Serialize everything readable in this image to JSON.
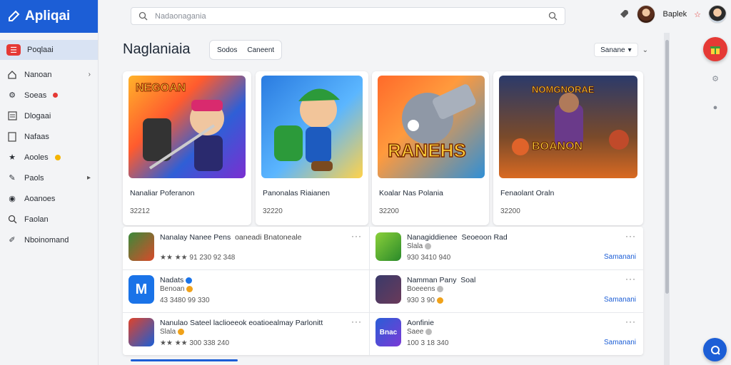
{
  "app": {
    "name": "Apliqai"
  },
  "search": {
    "placeholder": "Nadaonagania"
  },
  "user": {
    "name": "Baplek"
  },
  "sidebar": {
    "items": [
      {
        "label": "Poqlaai",
        "icon": "menu-icon",
        "active": true
      },
      {
        "label": "Nanoan",
        "icon": "home-icon",
        "chevron": true
      },
      {
        "label": "Soeas",
        "icon": "gear-icon",
        "badge": "red"
      },
      {
        "label": "Dlogaai",
        "icon": "list-icon"
      },
      {
        "label": "Nafaas",
        "icon": "document-icon"
      },
      {
        "label": "Aooles",
        "icon": "star-icon",
        "badge": "yellow"
      },
      {
        "label": "Paols",
        "icon": "pencil-icon",
        "chevron": true
      },
      {
        "label": "Aoanoes",
        "icon": "globe-icon"
      },
      {
        "label": "Faolan",
        "icon": "search-icon"
      },
      {
        "label": "Nboinomand",
        "icon": "pen-icon"
      }
    ]
  },
  "main": {
    "title": "Naglaniaia",
    "segments": [
      "Sodos",
      "Caneent"
    ],
    "sort": {
      "label": "Sanane"
    }
  },
  "cards": [
    {
      "title": "Nanaliar Poferanon",
      "meta": "32212",
      "art": "ninja"
    },
    {
      "title": "Panonalas Riaianen",
      "meta": "32220",
      "art": "runner"
    },
    {
      "title": "Koalar Nas Polania",
      "meta": "32200",
      "art": "cannon"
    },
    {
      "title": "Fenaolant Oraln",
      "meta": "32200",
      "art": "battle"
    }
  ],
  "list": [
    {
      "title": "Nanalay Nanee Pens",
      "extra": "oaneadi Bnatoneale",
      "sub": "",
      "rating": "★★ ★★ 91 230 92 348",
      "action": "",
      "thumb": "warrior"
    },
    {
      "title": "Nanagiddienee",
      "extra": "Seoeoon Rad",
      "sub": "Slala",
      "rating": "930 3410 940",
      "action": "Samanani",
      "thumb": "green"
    },
    {
      "title": "Nadats",
      "extra": "",
      "sub": "Benoan",
      "rating": "43 3480 99 330",
      "action": "",
      "thumb": "blue-m"
    },
    {
      "title": "Namman Pany",
      "extra": "Soal",
      "sub": "Boeeens",
      "rating": "930 3 90",
      "action": "Samanani",
      "thumb": "ninja"
    },
    {
      "title": "Nanulao Sateel laclioeeok",
      "extra": "eoatioealmay Parlonitt",
      "sub": "Slala",
      "rating": "★★ ★★ 300 338 240",
      "action": "",
      "thumb": "mario"
    },
    {
      "title": "Aonfinie",
      "extra": "",
      "sub": "Saee",
      "rating": "100 3 18 340",
      "action": "Samanani",
      "thumb": "brand"
    }
  ]
}
